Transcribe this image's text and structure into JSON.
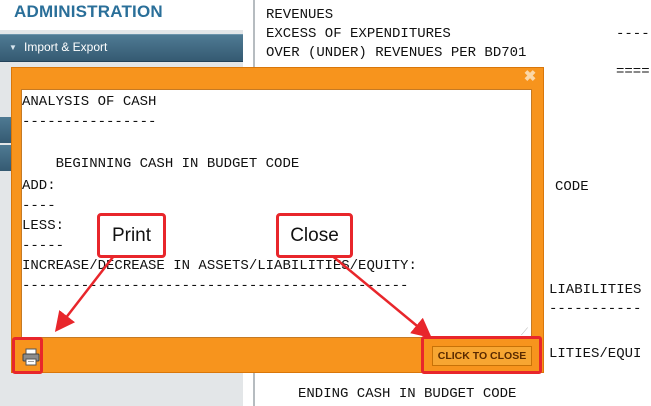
{
  "sidebar": {
    "title": "ADMINISTRATION",
    "items": [
      {
        "label": "Import & Export"
      }
    ]
  },
  "background_report": {
    "lines": [
      "REVENUES",
      "EXCESS OF EXPENDITURES",
      "OVER (UNDER) REVENUES PER BD701",
      "CODE",
      "LIABILITIES",
      "LITIES/EQUI",
      "ENDING CASH IN BUDGET CODE"
    ],
    "dashes_1": "----",
    "dashes_2": "====",
    "dashes_3": "-----------"
  },
  "dialog": {
    "close_x": "✖",
    "report_lines": [
      "ANALYSIS OF CASH",
      "----------------",
      "",
      "    BEGINNING CASH IN BUDGET CODE",
      "ADD:",
      "----",
      "LESS:",
      "-----",
      "INCREASE/DECREASE IN ASSETS/LIABILITIES/EQUITY:",
      "----------------------------------------------"
    ],
    "close_button_label": "CLICK TO CLOSE",
    "print_button_icon": "printer-icon"
  },
  "annotations": {
    "print_label": "Print",
    "close_label": "Close",
    "color": "#e8262b"
  },
  "colors": {
    "dialog_orange": "#f7941d",
    "sidebar_blue": "#2a6f99"
  }
}
